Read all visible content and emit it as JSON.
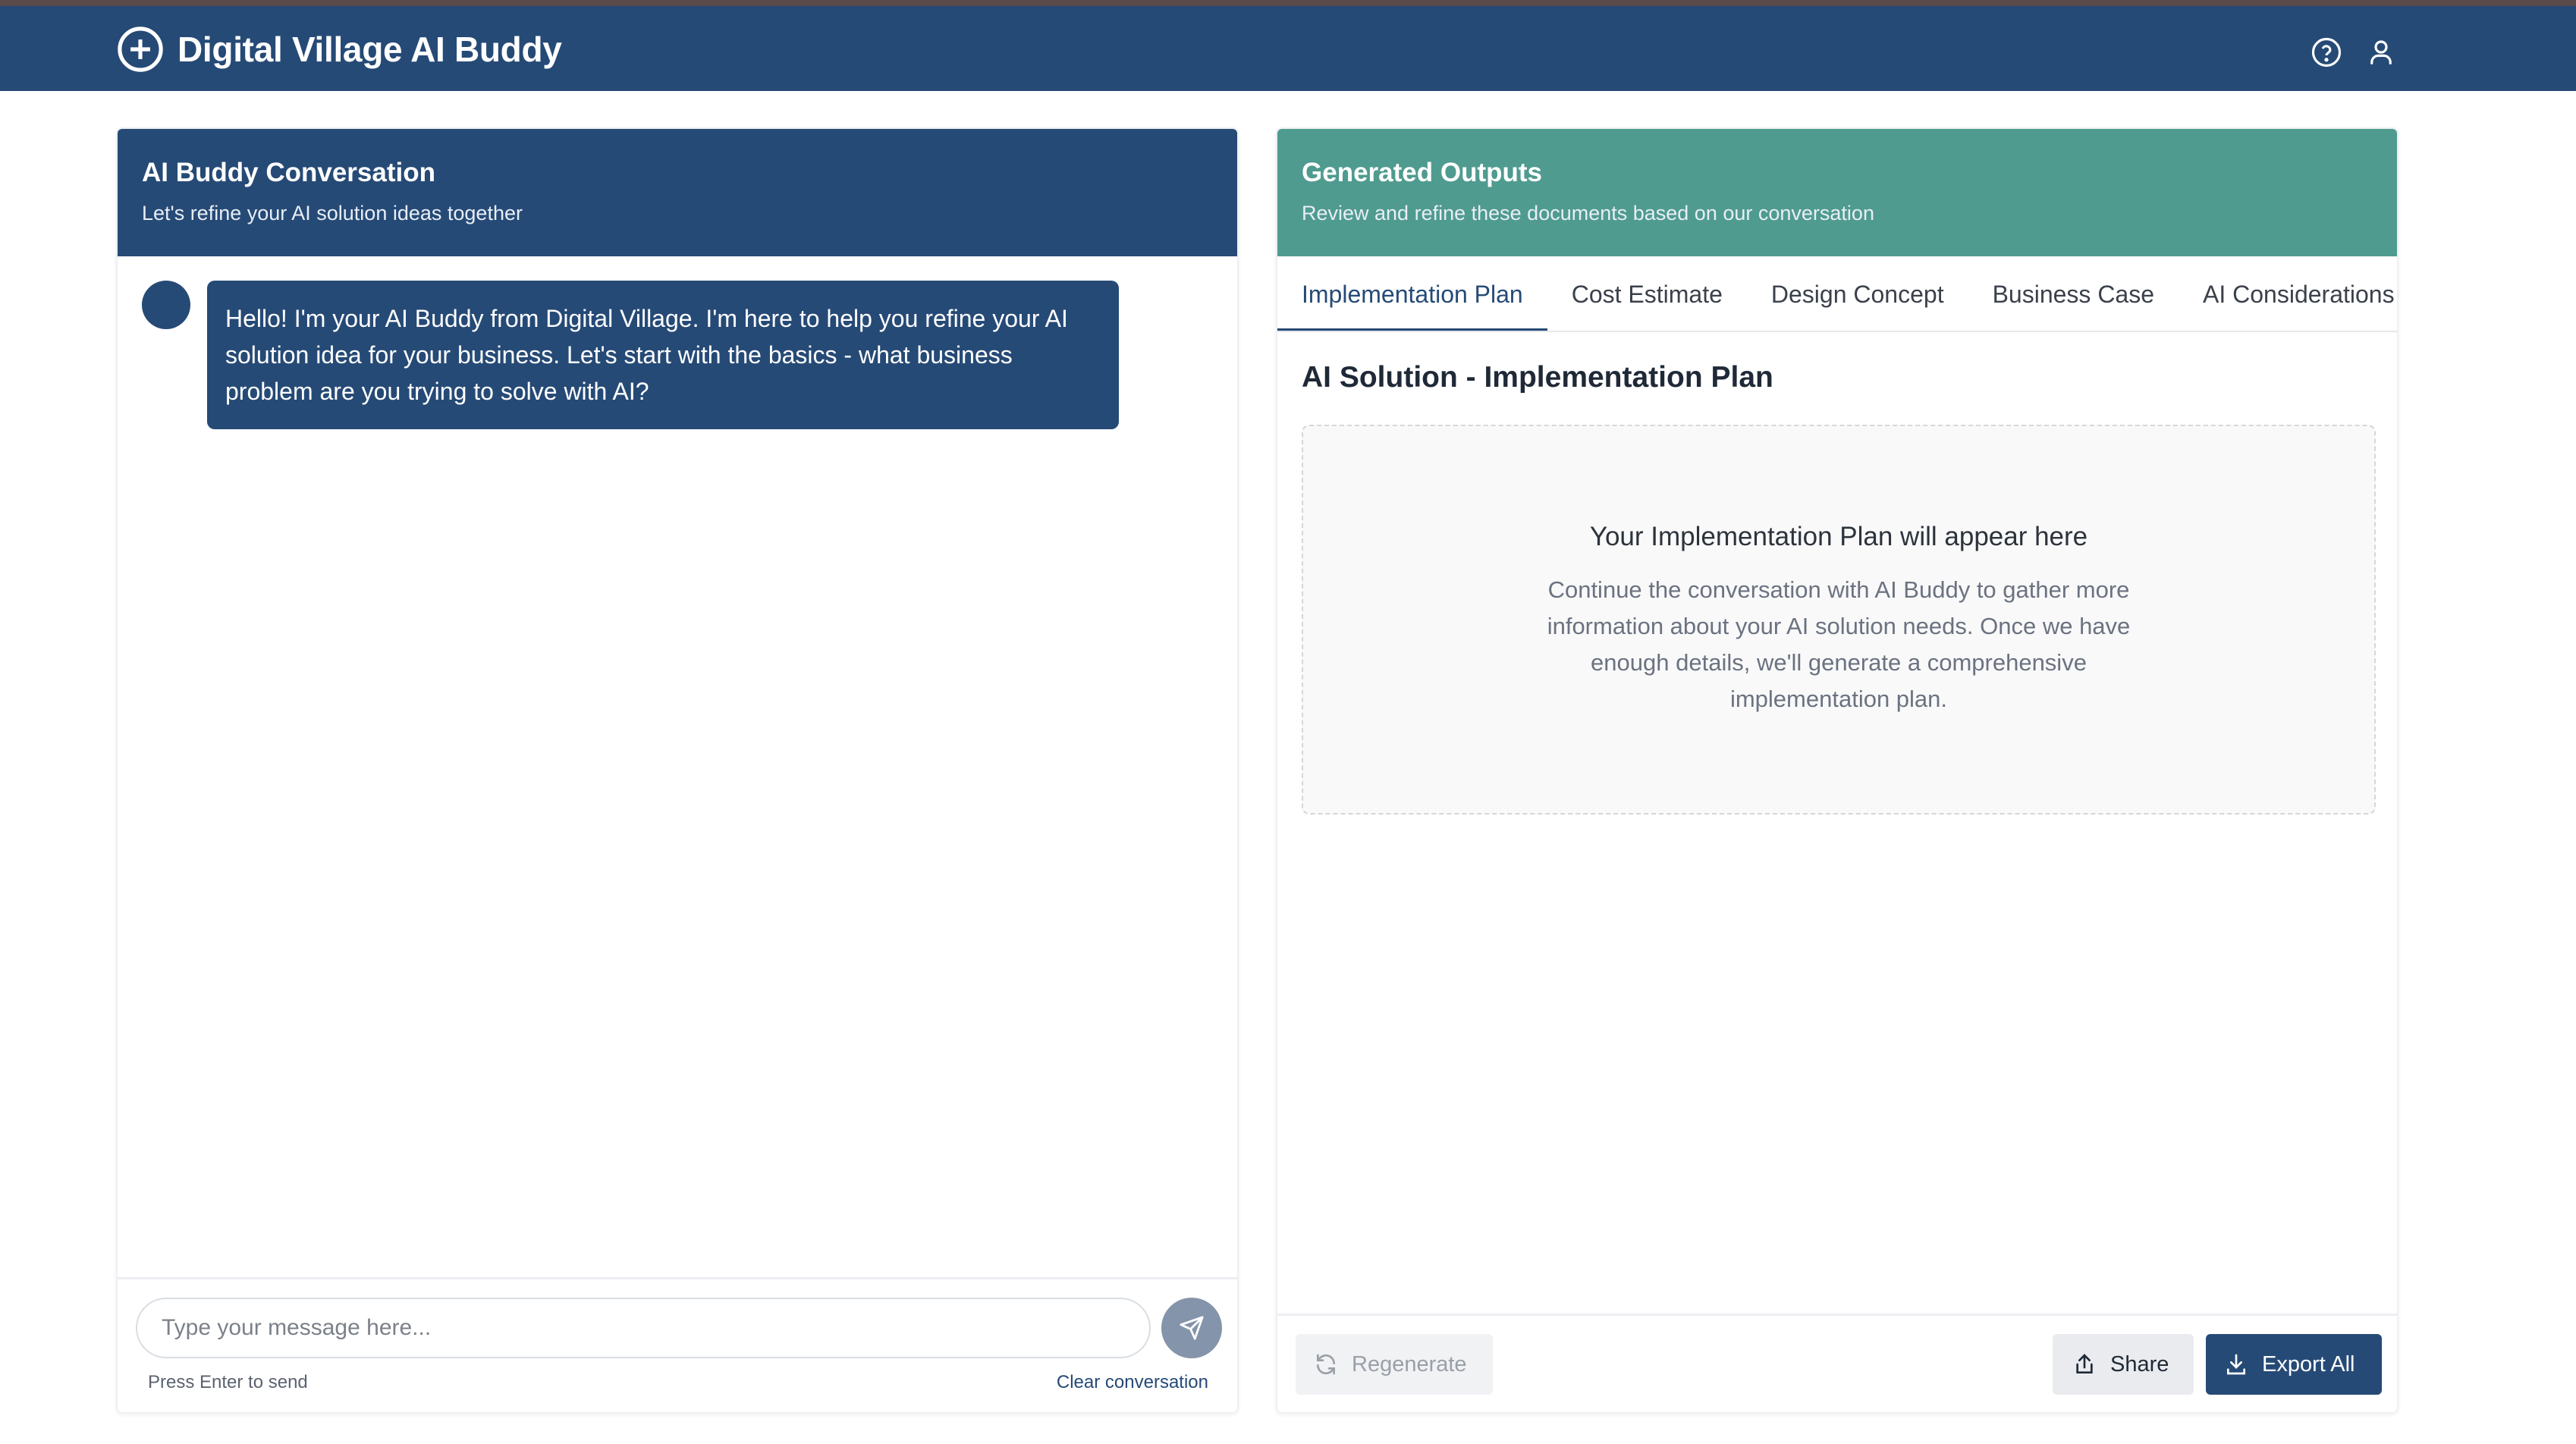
{
  "app": {
    "title": "Digital Village AI Buddy"
  },
  "chat": {
    "title": "AI Buddy Conversation",
    "subtitle": "Let's refine your AI solution ideas together",
    "messages": [
      {
        "sender": "assistant",
        "text": "Hello! I'm your AI Buddy from Digital Village. I'm here to help you refine your AI solution idea for your business. Let's start with the basics - what business problem are you trying to solve with AI?"
      }
    ],
    "input": {
      "placeholder": "Type your message here...",
      "value": ""
    },
    "hint": "Press Enter to send",
    "clear_label": "Clear conversation"
  },
  "outputs": {
    "title": "Generated Outputs",
    "subtitle": "Review and refine these documents based on our conversation",
    "tabs": [
      {
        "label": "Implementation Plan",
        "active": true
      },
      {
        "label": "Cost Estimate",
        "active": false
      },
      {
        "label": "Design Concept",
        "active": false
      },
      {
        "label": "Business Case",
        "active": false
      },
      {
        "label": "AI Considerations",
        "active": false
      }
    ],
    "doc_title": "AI Solution - Implementation Plan",
    "placeholder_title": "Your Implementation Plan will appear here",
    "placeholder_body": "Continue the conversation with AI Buddy to gather more information about your AI solution needs. Once we have enough details, we'll generate a comprehensive implementation plan.",
    "regenerate_label": "Regenerate",
    "share_label": "Share",
    "export_label": "Export All"
  },
  "colors": {
    "primary": "#264a76",
    "teal": "#4f9b8f"
  }
}
